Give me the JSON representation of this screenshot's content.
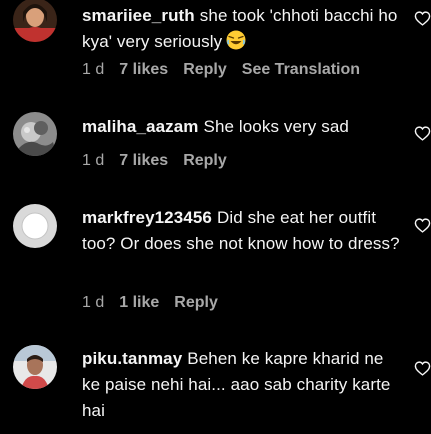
{
  "comments": [
    {
      "username": "smariiee_ruth",
      "text": "she took 'chhoti bacchi ho kya' very seriously",
      "emoji": "laughing-emoji",
      "time": "1 d",
      "likes": "7 likes",
      "reply": "Reply",
      "translate": "See Translation"
    },
    {
      "username": "maliha_aazam",
      "text": "She looks very sad",
      "time": "1 d",
      "likes": "7 likes",
      "reply": "Reply"
    },
    {
      "username": "markfrey123456",
      "text": "Did she eat her outfit too? Or does she not know how to dress?",
      "time": "1 d",
      "likes": "1 like",
      "reply": "Reply"
    },
    {
      "username": "piku.tanmay",
      "text": "Behen ke kapre kharid ne ke paise nehi hai... aao sab charity karte hai"
    }
  ],
  "colors": {
    "background": "#000000",
    "primary_text": "#f5f5f5",
    "secondary_text": "#a8a8a8"
  },
  "icons": {
    "like": "heart-outline-icon"
  }
}
